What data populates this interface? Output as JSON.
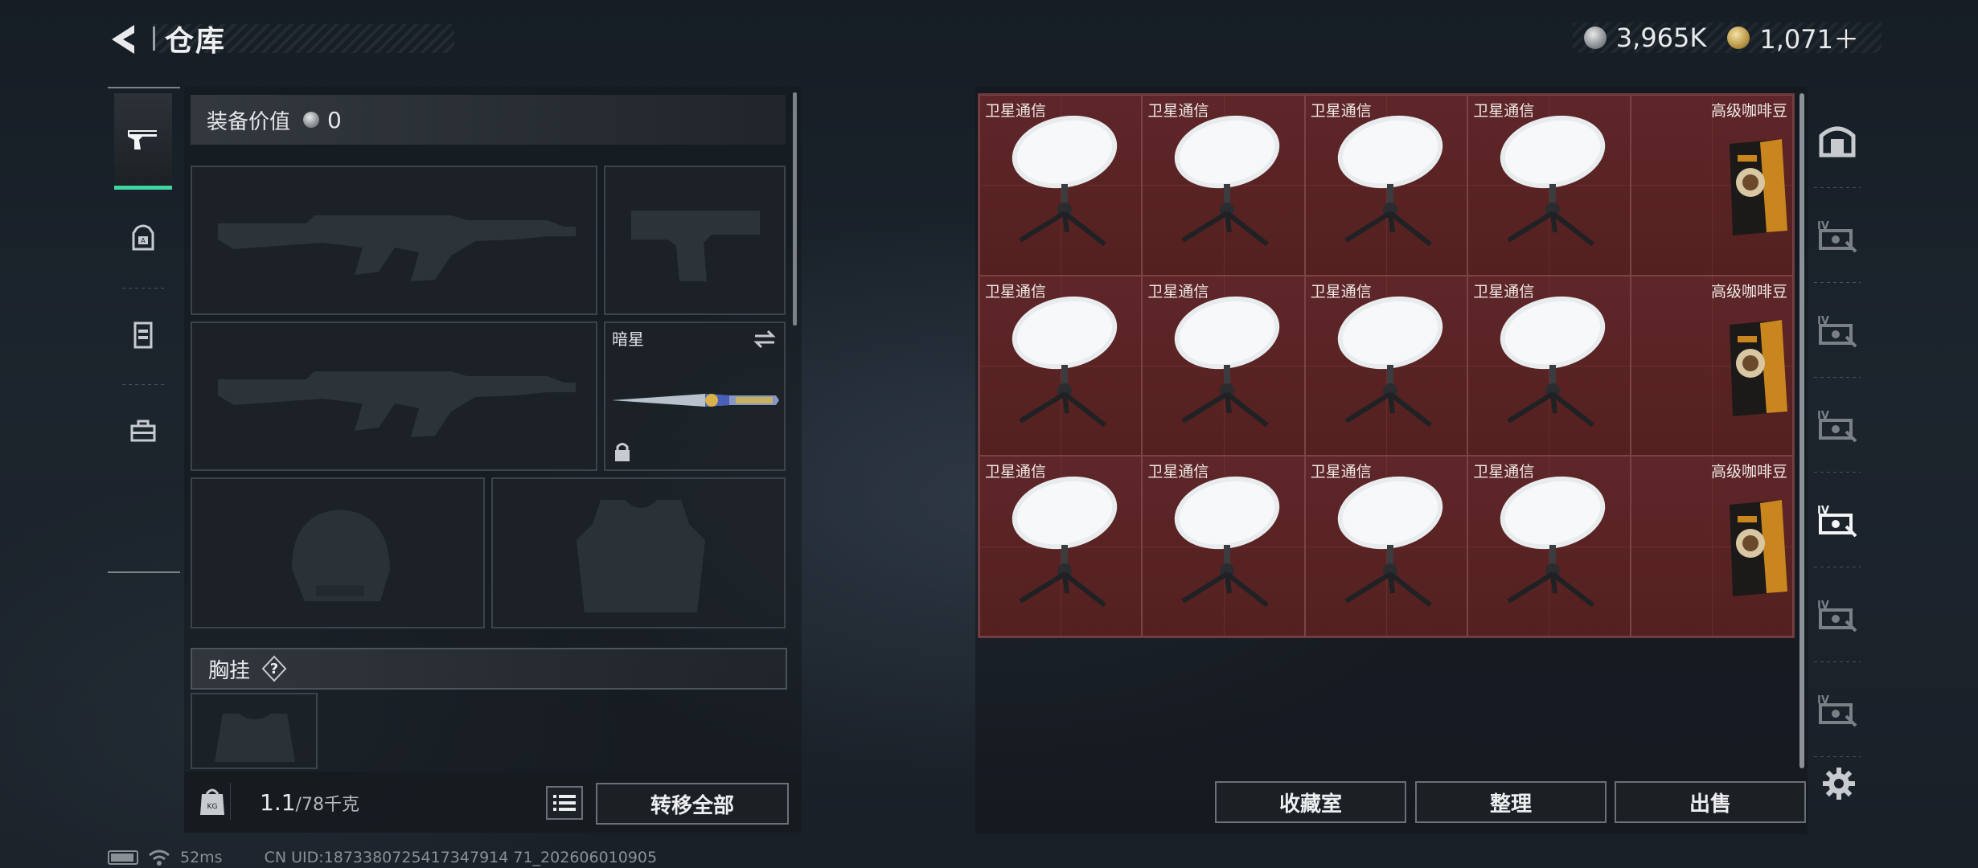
{
  "header": {
    "title": "仓库",
    "currency": [
      {
        "icon": "silver-coin-icon",
        "value": "3,965K"
      },
      {
        "icon": "gold-coin-icon",
        "value": "1,071＋"
      }
    ]
  },
  "left_nav": {
    "items": [
      {
        "icon": "pistol-icon",
        "active": true
      },
      {
        "icon": "backpack-icon",
        "active": false
      },
      {
        "icon": "vest-icon",
        "active": false
      },
      {
        "icon": "toolbox-icon",
        "active": false
      }
    ]
  },
  "loadout": {
    "equip_value_label": "装备价值",
    "equip_value": "0",
    "slots": {
      "primary_weapon_1": "rifle-silhouette",
      "pistol": "pistol-silhouette",
      "primary_weapon_2": "rifle-silhouette",
      "melee": {
        "label": "暗星",
        "icon": "knife-icon",
        "locked": true
      },
      "helmet": "helmet-silhouette",
      "armor": "armor-silhouette"
    },
    "chest_rig_label": "胸挂",
    "chest_rig_help": "?",
    "capacity_current": "1.1",
    "capacity_max": "/78千克",
    "transfer_all": "转移全部"
  },
  "storage": {
    "items": [
      {
        "name": "卫星通信",
        "type": "satellite-dish"
      },
      {
        "name": "卫星通信",
        "type": "satellite-dish"
      },
      {
        "name": "卫星通信",
        "type": "satellite-dish"
      },
      {
        "name": "卫星通信",
        "type": "satellite-dish"
      },
      {
        "name": "高级咖啡豆",
        "type": "coffee-bag"
      },
      {
        "name": "卫星通信",
        "type": "satellite-dish"
      },
      {
        "name": "卫星通信",
        "type": "satellite-dish"
      },
      {
        "name": "卫星通信",
        "type": "satellite-dish"
      },
      {
        "name": "卫星通信",
        "type": "satellite-dish"
      },
      {
        "name": "高级咖啡豆",
        "type": "coffee-bag"
      },
      {
        "name": "卫星通信",
        "type": "satellite-dish"
      },
      {
        "name": "卫星通信",
        "type": "satellite-dish"
      },
      {
        "name": "卫星通信",
        "type": "satellite-dish"
      },
      {
        "name": "卫星通信",
        "type": "satellite-dish"
      },
      {
        "name": "高级咖啡豆",
        "type": "coffee-bag"
      }
    ],
    "buttons": {
      "vault": "收藏室",
      "sort": "整理",
      "sell": "出售"
    }
  },
  "right_nav": {
    "items": [
      {
        "icon": "safe-room-icon"
      },
      {
        "icon": "storage-tier-iv-icon"
      },
      {
        "icon": "storage-tier-iv-icon"
      },
      {
        "icon": "storage-tier-iv-icon"
      },
      {
        "icon": "storage-tier-iv-icon",
        "active": true
      },
      {
        "icon": "storage-tier-iv-icon"
      },
      {
        "icon": "storage-tier-iv-icon"
      }
    ]
  },
  "status_bar": {
    "ping": "52ms",
    "uid": "CN UID:1873380725417347914 71_202606010905"
  },
  "colors": {
    "accent": "#3fd4a2",
    "item_bg": "#5a2528"
  }
}
